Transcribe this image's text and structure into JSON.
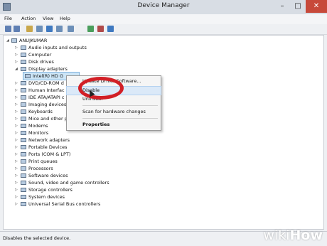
{
  "window": {
    "title": "Device Manager",
    "controls": {
      "minimize": "–",
      "maximize": "□",
      "close": "✕"
    }
  },
  "menubar": [
    "File",
    "Action",
    "View",
    "Help"
  ],
  "tree": {
    "root": "ANUJKUMAR",
    "items": [
      {
        "label": "Audio inputs and outputs",
        "arrow": "▷"
      },
      {
        "label": "Computer",
        "arrow": "▷"
      },
      {
        "label": "Disk drives",
        "arrow": "▷"
      },
      {
        "label": "Display adapters",
        "arrow": "◢"
      },
      {
        "label": "Intel(R) HD G",
        "child": true
      },
      {
        "label": "DVD/CD-ROM d",
        "arrow": "▷"
      },
      {
        "label": "Human Interfac",
        "arrow": "▷"
      },
      {
        "label": "IDE ATA/ATAPI c",
        "arrow": "▷"
      },
      {
        "label": "Imaging devices",
        "arrow": "▷"
      },
      {
        "label": "Keyboards",
        "arrow": "▷"
      },
      {
        "label": "Mice and other p",
        "arrow": "▷"
      },
      {
        "label": "Modems",
        "arrow": "▷"
      },
      {
        "label": "Monitors",
        "arrow": "▷"
      },
      {
        "label": "Network adapters",
        "arrow": "▷"
      },
      {
        "label": "Portable Devices",
        "arrow": "▷"
      },
      {
        "label": "Ports (COM & LPT)",
        "arrow": "▷"
      },
      {
        "label": "Print queues",
        "arrow": "▷"
      },
      {
        "label": "Processors",
        "arrow": "▷"
      },
      {
        "label": "Software devices",
        "arrow": "▷"
      },
      {
        "label": "Sound, video and game controllers",
        "arrow": "▷"
      },
      {
        "label": "Storage controllers",
        "arrow": "▷"
      },
      {
        "label": "System devices",
        "arrow": "▷"
      },
      {
        "label": "Universal Serial Bus controllers",
        "arrow": "▷"
      }
    ]
  },
  "context_menu": {
    "update": "Update Driver Software...",
    "disable": "Disable",
    "uninstall": "Uninstall",
    "scan": "Scan for hardware changes",
    "properties": "Properties"
  },
  "status": "Disables the selected device.",
  "watermark": {
    "a": "wiki",
    "b": "How"
  },
  "colors": {
    "highlight_ellipse": "#d21f26",
    "close_button": "#c7493a"
  }
}
